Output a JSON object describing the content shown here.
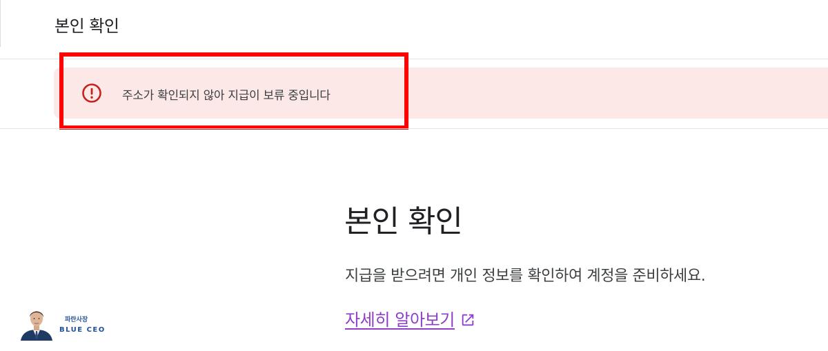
{
  "header": {
    "title": "본인 확인"
  },
  "alert": {
    "icon": "error-circle-icon",
    "message": "주소가 확인되지 않아 지급이 보류 중입니다",
    "background_color": "#fce8e6",
    "icon_color": "#c5221f",
    "annotation_color": "#ff0000"
  },
  "main": {
    "title": "본인 확인",
    "description": "지급을 받으려면 개인 정보를 확인하여 계정을 준비하세요.",
    "learn_more": {
      "label": "자세히 알아보기",
      "icon": "external-link-icon",
      "color": "#8e3dc9"
    }
  },
  "watermark": {
    "top_text": "파란사장",
    "bottom_text": "BLUE CEO",
    "icon": "avatar-icon"
  }
}
